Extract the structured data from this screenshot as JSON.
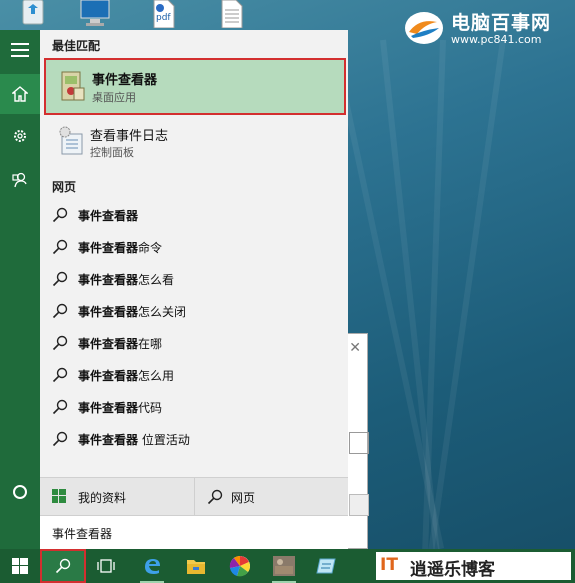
{
  "watermark": {
    "title": "电脑百事网",
    "url": "www.pc841.com",
    "corner_brand": "逍遥乐博客",
    "corner_brand_mark": "IT"
  },
  "desktop_icons": [
    "recycle-bin-icon",
    "computer-icon",
    "pdf-file-icon",
    "text-file-icon"
  ],
  "rail": {
    "items": [
      "hamburger-icon",
      "home-icon",
      "settings-icon",
      "feedback-icon",
      "cortana-circle-icon"
    ]
  },
  "search": {
    "best_match_label": "最佳匹配",
    "best_match": {
      "title": "事件查看器",
      "subtitle": "桌面应用",
      "icon": "event-viewer-icon"
    },
    "other_result": {
      "title": "查看事件日志",
      "subtitle": "控制面板",
      "icon": "control-panel-log-icon"
    },
    "web_label": "网页",
    "web_results": [
      {
        "bold": "事件查看器",
        "rest": ""
      },
      {
        "bold": "事件查看器",
        "rest": "命令"
      },
      {
        "bold": "事件查看器",
        "rest": "怎么看"
      },
      {
        "bold": "事件查看器",
        "rest": "怎么关闭"
      },
      {
        "bold": "事件查看器",
        "rest": "在哪"
      },
      {
        "bold": "事件查看器",
        "rest": "怎么用"
      },
      {
        "bold": "事件查看器",
        "rest": "代码"
      },
      {
        "bold": "事件查看器",
        "rest": " 位置活动"
      }
    ],
    "my_stuff_label": "我的资料",
    "web_button_label": "网页",
    "query": "事件查看器"
  },
  "taskbar": {
    "items": [
      "start-icon",
      "search-icon",
      "task-view-icon",
      "edge-icon",
      "file-explorer-icon",
      "pinwheel-app-icon",
      "photo-app-icon",
      "app-icon"
    ]
  },
  "colors": {
    "accent": "#1f6b3b",
    "highlight": "#b6dbbd",
    "annotation_red": "#d32f2f"
  }
}
